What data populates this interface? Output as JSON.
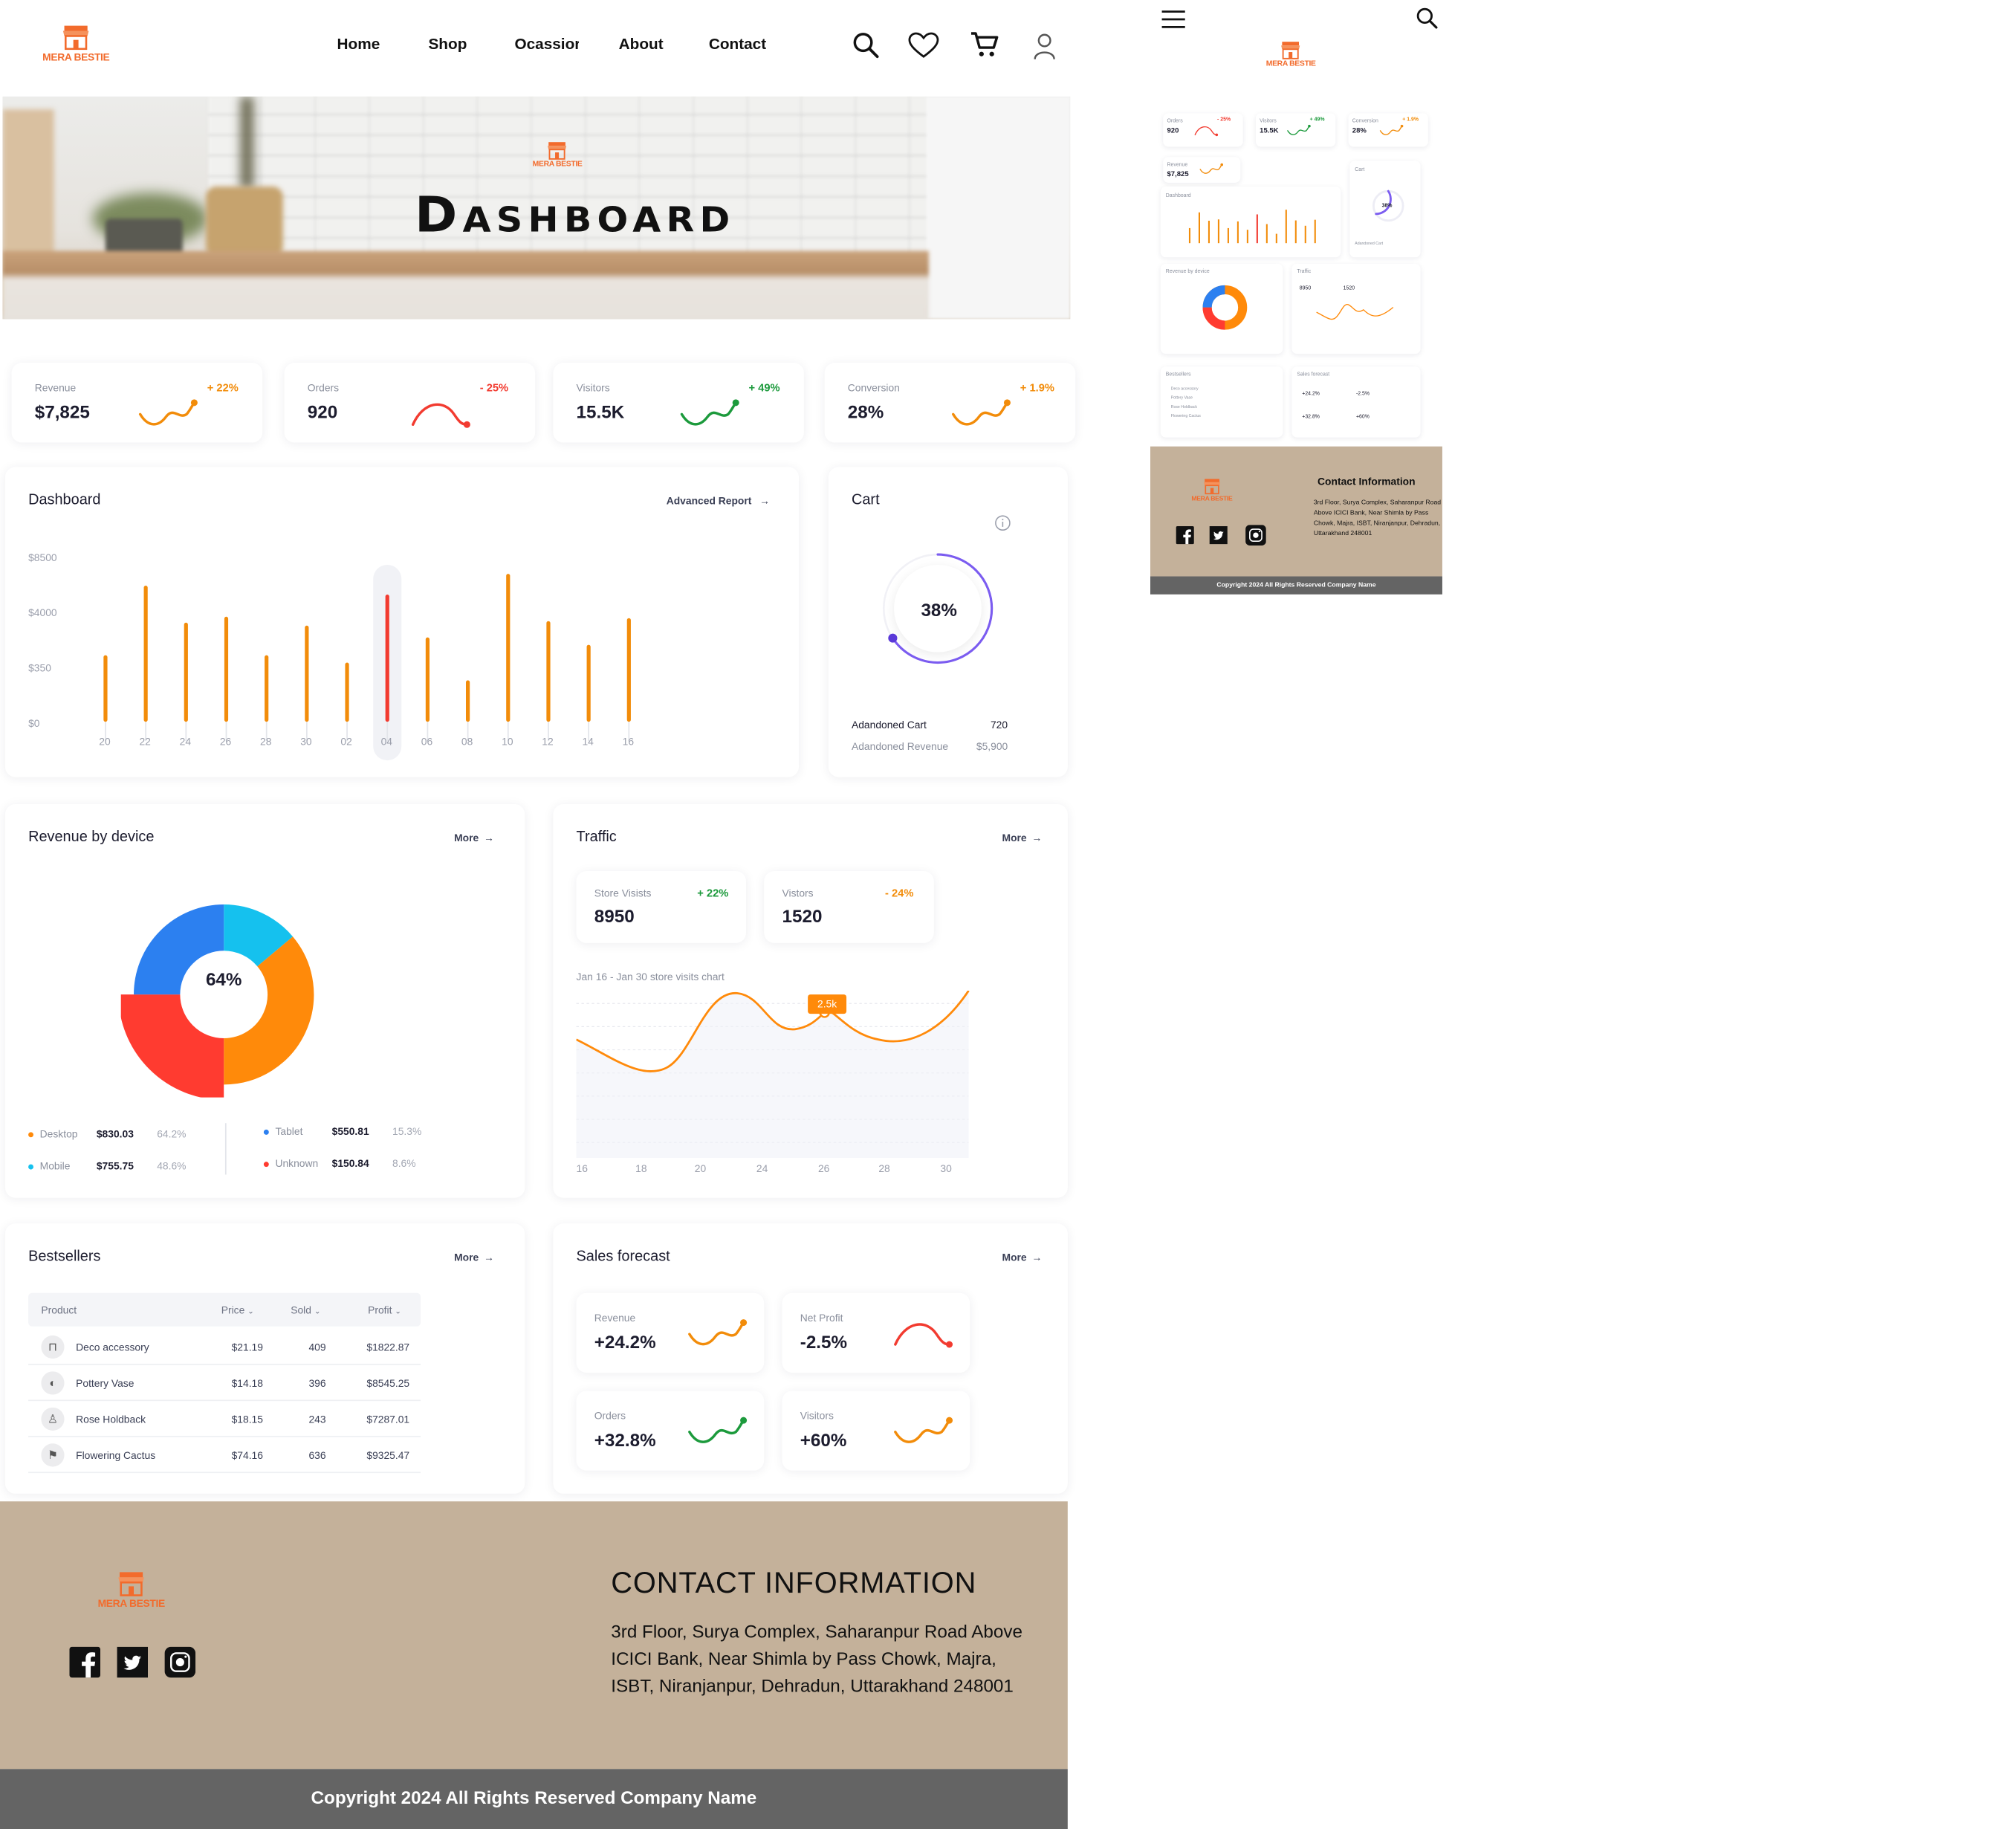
{
  "brand": {
    "name": "MERA BESTIE",
    "accent": "#f26b2c"
  },
  "nav": {
    "items": [
      "Home",
      "Shop",
      "Ocassior",
      "About",
      "Contact"
    ]
  },
  "hero": {
    "title": "Dashboard"
  },
  "stats": [
    {
      "label": "Revenue",
      "value": "$7,825",
      "change": "+ 22%",
      "color": "#f28c0a"
    },
    {
      "label": "Orders",
      "value": "920",
      "change": "- 25%",
      "color": "#f23b30"
    },
    {
      "label": "Visitors",
      "value": "15.5K",
      "change": "+ 49%",
      "color": "#1c9a3c"
    },
    {
      "label": "Conversion",
      "value": "28%",
      "change": "+ 1.9%",
      "color": "#f28c0a"
    }
  ],
  "dashboard": {
    "title": "Dashboard",
    "advanced_label": "Advanced Report",
    "chart_data": {
      "type": "bar",
      "categories": [
        "20",
        "22",
        "24",
        "26",
        "28",
        "30",
        "02",
        "04",
        "06",
        "08",
        "10",
        "12",
        "14",
        "16"
      ],
      "values": [
        0.45,
        0.92,
        0.67,
        0.71,
        0.45,
        0.65,
        0.4,
        0.86,
        0.57,
        0.28,
        1.0,
        0.68,
        0.52,
        0.7
      ],
      "highlight_index": 7,
      "y_ticks": [
        "$8500",
        "$4000",
        "$350",
        "$0"
      ]
    }
  },
  "cart": {
    "title": "Cart",
    "percent": "38%",
    "percent_value": 0.38,
    "rows": [
      {
        "label": "Adandoned Cart",
        "value": "720"
      },
      {
        "label": "Adandoned Revenue",
        "value": "$5,900"
      }
    ]
  },
  "revenue_device": {
    "title": "Revenue by device",
    "more": "More",
    "center": "64%",
    "chart_data": {
      "type": "pie",
      "categories": [
        "Desktop",
        "Mobile",
        "Tablet",
        "Unknown"
      ],
      "values": [
        830.03,
        755.75,
        550.81,
        150.84
      ]
    },
    "legend": [
      {
        "name": "Desktop",
        "amount": "$830.03",
        "pct": "64.2%",
        "color": "#ff8a0a"
      },
      {
        "name": "Mobile",
        "amount": "$755.75",
        "pct": "48.6%",
        "color": "#15c1ee"
      },
      {
        "name": "Tablet",
        "amount": "$550.81",
        "pct": "15.3%",
        "color": "#2c80f0"
      },
      {
        "name": "Unknown",
        "amount": "$150.84",
        "pct": "8.6%",
        "color": "#ff3b30"
      }
    ]
  },
  "traffic": {
    "title": "Traffic",
    "more": "More",
    "cards": [
      {
        "label": "Store Visists",
        "value": "8950",
        "change": "+ 22%",
        "color": "#1c9a3c"
      },
      {
        "label": "Vistors",
        "value": "1520",
        "change": "- 24%",
        "color": "#f28c0a"
      }
    ],
    "chart_caption": "Jan 16 - Jan 30 store visits chart",
    "tooltip": "2.5k",
    "chart_data": {
      "type": "line",
      "x": [
        "16",
        "18",
        "20",
        "24",
        "26",
        "28",
        "30"
      ]
    }
  },
  "bestsellers": {
    "title": "Bestsellers",
    "more": "More",
    "columns": [
      "Product",
      "Price",
      "Sold",
      "Profit"
    ],
    "rows": [
      {
        "product": "Deco accessory",
        "price": "$21.19",
        "sold": "409",
        "profit": "$1822.87"
      },
      {
        "product": "Pottery Vase",
        "price": "$14.18",
        "sold": "396",
        "profit": "$8545.25"
      },
      {
        "product": "Rose Holdback",
        "price": "$18.15",
        "sold": "243",
        "profit": "$7287.01"
      },
      {
        "product": "Flowering Cactus",
        "price": "$74.16",
        "sold": "636",
        "profit": "$9325.47"
      }
    ]
  },
  "forecast": {
    "title": "Sales forecast",
    "more": "More",
    "cards": [
      {
        "label": "Revenue",
        "value": "+24.2%",
        "color": "#f28c0a"
      },
      {
        "label": "Net Profit",
        "value": "-2.5%",
        "color": "#f23b30"
      },
      {
        "label": "Orders",
        "value": "+32.8%",
        "color": "#1c9a3c"
      },
      {
        "label": "Visitors",
        "value": "+60%",
        "color": "#f28c0a"
      }
    ]
  },
  "footer": {
    "heading": "CONTACT INFORMATION",
    "heading_mobile": "Contact Information",
    "address": "3rd Floor, Surya Complex, Saharanpur Road Above ICICI Bank, Near Shimla by Pass Chowk, Majra, ISBT, Niranjanpur, Dehradun, Uttarakhand 248001",
    "copyright": "Copyright 2024 All Rights Reserved Company Name"
  }
}
